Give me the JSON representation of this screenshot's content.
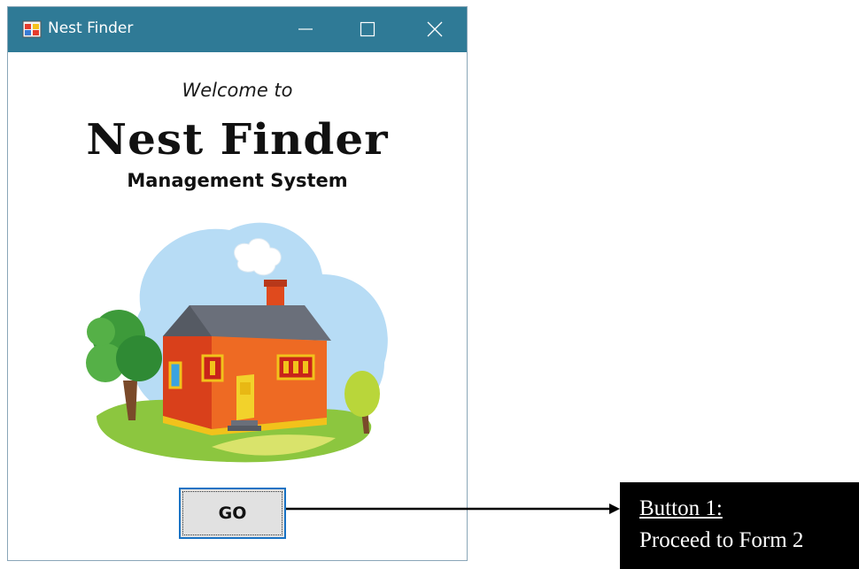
{
  "window": {
    "title": "Nest Finder",
    "controls": {
      "minimize_icon": "minimize-icon",
      "maximize_icon": "maximize-icon",
      "close_icon": "close-icon"
    }
  },
  "content": {
    "welcome_text": "Welcome to",
    "brand_text": "Nest Finder",
    "subtitle_text": "Management System",
    "illustration_icon": "house-illustration",
    "go_button_label": "GO"
  },
  "annotation": {
    "heading": "Button 1:",
    "description": "Proceed to Form 2"
  },
  "colors": {
    "titlebar": "#2f7a96",
    "button_border": "#1a73c4",
    "callout_background": "#000000"
  }
}
